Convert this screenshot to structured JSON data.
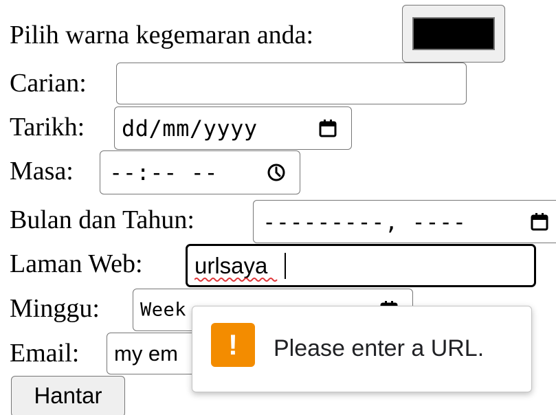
{
  "form": {
    "color": {
      "label": "Pilih warna kegemaran anda:",
      "value_color": "#000000"
    },
    "search": {
      "label": "Carian:",
      "value": ""
    },
    "date": {
      "label": "Tarikh:",
      "placeholder": "dd/mm/yyyy",
      "icon": "calendar-icon"
    },
    "time": {
      "label": "Masa:",
      "placeholder": "--:-- --",
      "icon": "clock-icon"
    },
    "month": {
      "label": "Bulan dan Tahun:",
      "placeholder": "---------, ----",
      "icon": "calendar-icon"
    },
    "url": {
      "label": "Laman Web:",
      "value": "urlsaya"
    },
    "week": {
      "label": "Minggu:",
      "placeholder": "Week",
      "icon": "calendar-icon"
    },
    "email": {
      "label": "Email:",
      "value": "my em"
    },
    "submit": {
      "label": "Hantar"
    }
  },
  "validation": {
    "message": "Please enter a URL.",
    "icon": "warning-icon",
    "icon_glyph": "!",
    "icon_color": "#f38c00"
  },
  "colors": {
    "focus_border": "#000000",
    "field_border": "#767676",
    "button_bg": "#efefef",
    "spellcheck_underline": "#e0373a"
  }
}
